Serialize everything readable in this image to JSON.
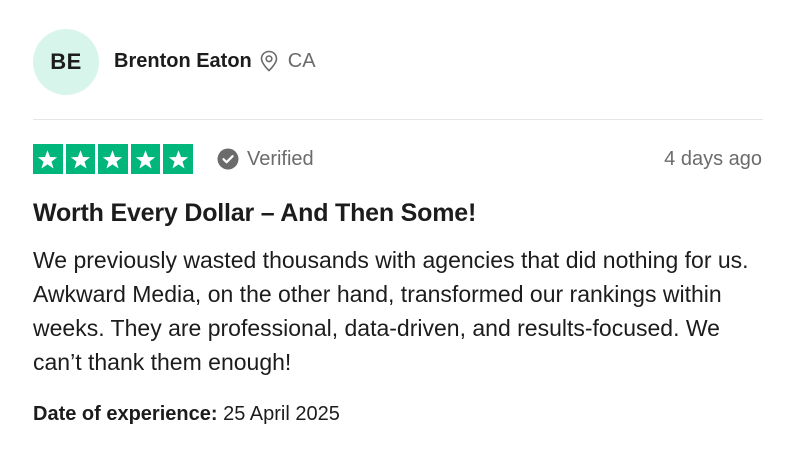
{
  "reviewer": {
    "initials": "BE",
    "name": "Brenton Eaton",
    "country": "CA",
    "avatar_color": "#d7f5ea"
  },
  "rating": {
    "stars": 5,
    "max_stars": 5,
    "star_color": "#00b67a",
    "star_icon": "star-icon"
  },
  "verified": {
    "label": "Verified",
    "icon": "check-circle-icon"
  },
  "date_ago": "4 days ago",
  "review": {
    "title": "Worth Every Dollar – And Then Some!",
    "body": "We previously wasted thousands with agencies that did nothing for us. Awkward Media, on the other hand, transformed our rankings within weeks. They are professional, data-driven, and results-focused. We can’t thank them enough!"
  },
  "experience": {
    "label": "Date of experience:",
    "date": "25 April 2025"
  }
}
